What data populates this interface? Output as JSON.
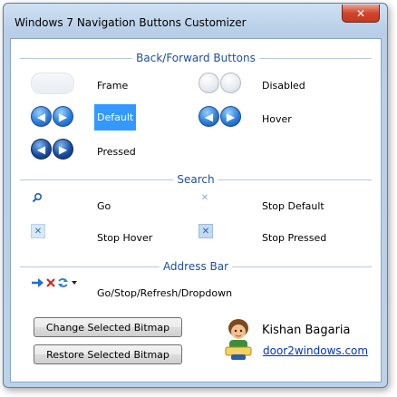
{
  "window": {
    "title": "Windows 7 Navigation Buttons Customizer",
    "close_label": "✕"
  },
  "sections": {
    "back_forward": "Back/Forward Buttons",
    "search": "Search",
    "address_bar": "Address Bar"
  },
  "back_forward_items": {
    "frame": "Frame",
    "disabled": "Disabled",
    "default": "Default",
    "hover": "Hover",
    "pressed": "Pressed"
  },
  "search_items": {
    "go": "Go",
    "stop_default": "Stop Default",
    "stop_hover": "Stop Hover",
    "stop_pressed": "Stop Pressed"
  },
  "address_items": {
    "combined": "Go/Stop/Refresh/Dropdown"
  },
  "buttons": {
    "change": "Change Selected Bitmap",
    "restore": "Restore Selected Bitmap"
  },
  "author": {
    "name": "Kishan Bagaria",
    "link": "door2windows.com"
  },
  "icons": {
    "back_arrow": "◀",
    "forward_arrow": "▶",
    "search": "search-icon",
    "stop": "✕"
  }
}
